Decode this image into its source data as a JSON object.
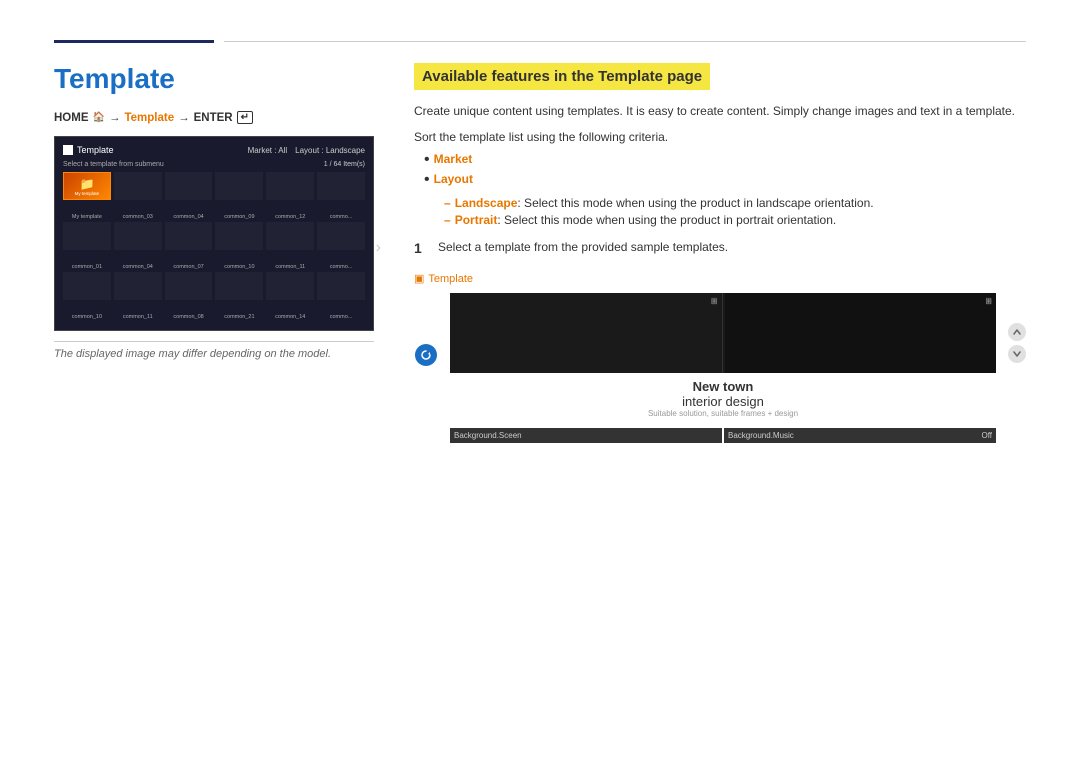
{
  "header": {
    "left_line_color": "#1a2a5e",
    "right_line_color": "#cccccc"
  },
  "left": {
    "page_title": "Template",
    "breadcrumb": {
      "home": "HOME",
      "arrow1": "→",
      "current": "Template",
      "arrow2": "→",
      "enter": "ENTER"
    },
    "ui": {
      "title": "Template",
      "subtitle": "Select a template from submenu",
      "market_label": "Market : All",
      "layout_label": "Layout : Landscape",
      "count": "1 / 64 Item(s)",
      "my_template": "My template",
      "items": [
        "common_03",
        "common_04",
        "common_09",
        "common_12",
        "common_",
        "common_01",
        "common_04",
        "common_07",
        "common_10",
        "common_11",
        "common_",
        "common_10",
        "common_11",
        "common_08",
        "common_21",
        "common_14",
        "common_"
      ]
    },
    "note": "The displayed image may differ depending on the model."
  },
  "right": {
    "feature_title": "Available features in the Template page",
    "description": "Create unique content using templates. It is easy to create content. Simply change images and text in a template.",
    "sort_description": "Sort the template list using the following criteria.",
    "bullets": [
      {
        "label": "Market",
        "children": []
      },
      {
        "label": "Layout",
        "children": [
          {
            "label": "Landscape",
            "text": ": Select this mode when using the product in landscape orientation."
          },
          {
            "label": "Portrait",
            "text": ": Select this mode when using the product in portrait orientation."
          }
        ]
      }
    ],
    "steps": [
      {
        "number": "1",
        "text": "Select a template from the provided sample templates."
      }
    ],
    "preview": {
      "label": "Template",
      "title1": "New town",
      "title2": "interior design",
      "small_text": "Suitable solution, suitable frames + design",
      "btn1_label": "Background.Sceen",
      "btn1_value": "",
      "btn2_label": "Background.Music",
      "btn2_value": "Off"
    }
  }
}
